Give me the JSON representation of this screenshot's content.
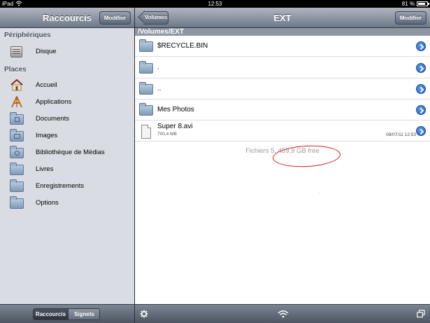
{
  "statusbar": {
    "carrier": "iPad",
    "time": "12:53",
    "battery": "81 %",
    "battery_level": 0.81
  },
  "sidebar": {
    "title": "Raccourcis",
    "edit_label": "Modifier",
    "devices_header": "Périphériques",
    "devices": [
      {
        "label": "Disque",
        "icon": "disk-icon"
      }
    ],
    "places_header": "Places",
    "places": [
      {
        "label": "Accueil",
        "icon": "home-icon"
      },
      {
        "label": "Applications",
        "icon": "applications-icon"
      },
      {
        "label": "Documents",
        "icon": "documents-folder-icon"
      },
      {
        "label": "Images",
        "icon": "images-folder-icon"
      },
      {
        "label": "Bibliothèque de Médias",
        "icon": "media-folder-icon"
      },
      {
        "label": "Livres",
        "icon": "folder-icon"
      },
      {
        "label": "Enregistrements",
        "icon": "folder-icon"
      },
      {
        "label": "Options",
        "icon": "folder-icon"
      }
    ],
    "tabs": [
      {
        "label": "Raccourcis",
        "selected": true
      },
      {
        "label": "Signets",
        "selected": false
      }
    ]
  },
  "browser": {
    "back_label": "Volumes",
    "title": "EXT",
    "edit_label": "Modifier",
    "path": "/Volumes/EXT",
    "items": [
      {
        "name": "$RECYCLE.BIN",
        "type": "folder"
      },
      {
        "name": ".",
        "type": "folder"
      },
      {
        "name": "..",
        "type": "folder"
      },
      {
        "name": "Mes Photos",
        "type": "folder"
      },
      {
        "name": "Super 8.avi",
        "type": "file",
        "size": "700,4 MB",
        "date": "08/07/11 12:53"
      }
    ],
    "summary": "Fichiers 5, 459,9 GB free"
  },
  "colors": {
    "highlight_circle": "#dd1111",
    "disclosure": "#1f5fc4"
  }
}
